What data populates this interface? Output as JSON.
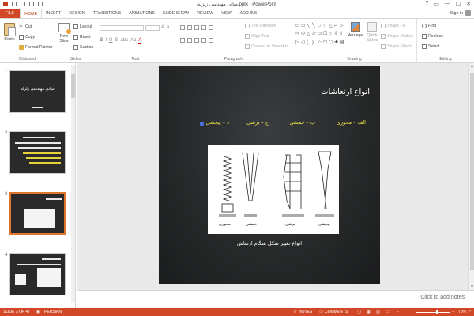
{
  "window": {
    "title": "مبانی مهندسی زلزله.pptx - PowerPoint",
    "controls": {
      "help": "?",
      "restore": "▭",
      "minimize": "—",
      "maximize": "☐",
      "close": "✕"
    }
  },
  "tabs": [
    {
      "label": "FILE"
    },
    {
      "label": "HOME"
    },
    {
      "label": "INSERT"
    },
    {
      "label": "DESIGN"
    },
    {
      "label": "TRANSITIONS"
    },
    {
      "label": "ANIMATIONS"
    },
    {
      "label": "SLIDE SHOW"
    },
    {
      "label": "REVIEW"
    },
    {
      "label": "VIEW"
    },
    {
      "label": "ADD-INS"
    }
  ],
  "account": {
    "signin": "Sign in"
  },
  "ribbon": {
    "clipboard": {
      "label": "Clipboard",
      "paste": "Paste",
      "cut": "Cut",
      "copy": "Copy",
      "format_painter": "Format Painter"
    },
    "slides": {
      "label": "Slides",
      "new_slide_1": "New",
      "new_slide_2": "Slide",
      "layout": "Layout",
      "reset": "Reset",
      "section": "Section"
    },
    "font": {
      "label": "Font",
      "bold": "B",
      "italic": "I",
      "underline": "U",
      "shadow": "S",
      "strike": "abc",
      "aa": "Aa",
      "color": "A"
    },
    "paragraph": {
      "label": "Paragraph",
      "text_direction": "Text Direction",
      "align_text": "Align Text",
      "convert_smartart": "Convert to SmartArt"
    },
    "drawing": {
      "label": "Drawing",
      "shapes": [
        "▭",
        "▭",
        "╲",
        "╲",
        "□",
        "○",
        "△",
        "⌐",
        "▷",
        "⇨",
        "⬭",
        "△",
        "▱",
        "▭",
        "☐",
        "⌂",
        "⇩",
        "⇧",
        "▷",
        "◁",
        "{",
        "}",
        "☆",
        "⬠",
        "⬡",
        "✚",
        "▤"
      ],
      "arrange": "Arrange",
      "quick_styles_1": "Quick",
      "quick_styles_2": "Styles",
      "shape_fill": "Shape Fill",
      "shape_outline": "Shape Outline",
      "shape_effects": "Shape Effects"
    },
    "editing": {
      "label": "Editing",
      "find": "Find",
      "replace": "Replace",
      "select": "Select"
    }
  },
  "thumbnails": [
    {
      "num": "1",
      "title": "مبانی مهندسی زلزله"
    },
    {
      "num": "2"
    },
    {
      "num": "3",
      "selected": true
    },
    {
      "num": "4"
    }
  ],
  "slide": {
    "title": "انواع ارتعاشات",
    "types": [
      "الف – محوری",
      "ب – خمشی",
      "ج – برشی",
      "د – پیچشی"
    ],
    "figure_labels": [
      "محوری",
      "خمشی",
      "برشی",
      "پیچشی"
    ],
    "caption": "انواع تغییر شکل هنگام ارتعاش"
  },
  "notes": {
    "placeholder": "Click to add notes"
  },
  "status": {
    "slide": "SLIDE 3 OF 47",
    "language": "PERSIAN",
    "notes": "NOTES",
    "comments": "COMMENTS",
    "zoom": "70%",
    "zoom_level": 0.6
  },
  "colors": {
    "accent": "#d24726",
    "slide_text_yellow": "#f0e44a",
    "bullet": "#4a6ed8"
  }
}
